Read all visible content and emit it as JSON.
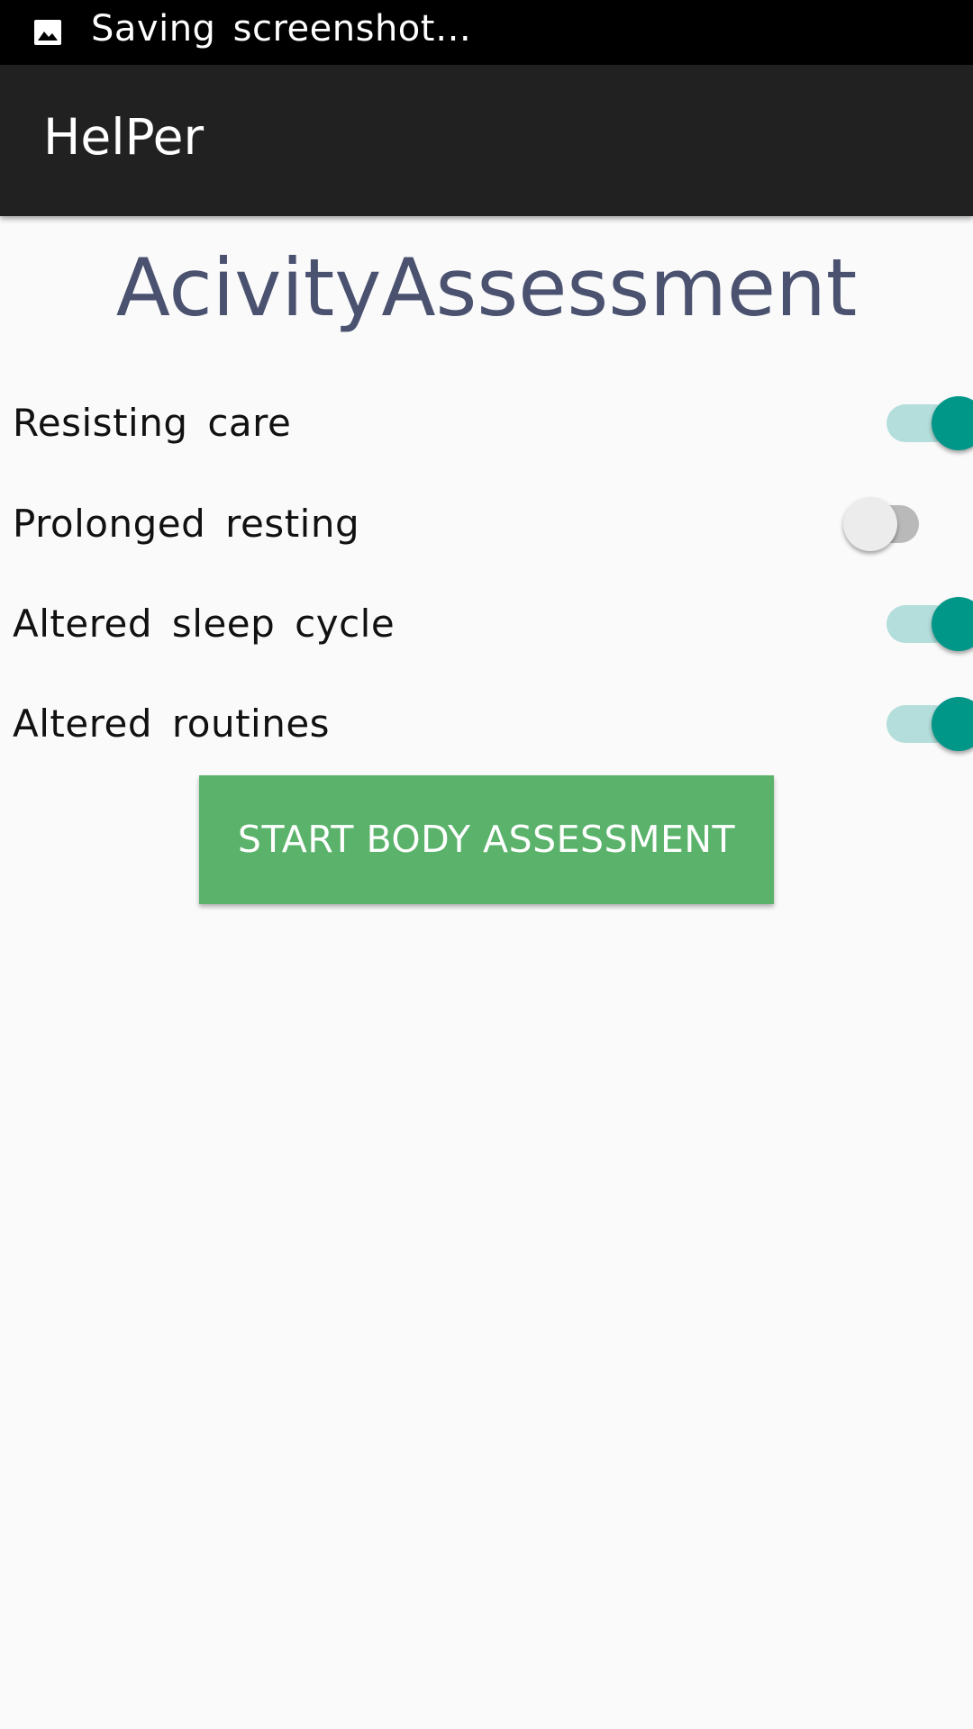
{
  "status_bar": {
    "icon": "image-icon",
    "text": "Saving screenshot…"
  },
  "app_bar": {
    "title": "HelPer"
  },
  "page": {
    "title": "AcivityAssessment"
  },
  "toggles": [
    {
      "label": "Resisting care",
      "on": true
    },
    {
      "label": "Prolonged resting",
      "on": false
    },
    {
      "label": "Altered sleep cycle",
      "on": true
    },
    {
      "label": "Altered routines",
      "on": true
    }
  ],
  "actions": {
    "start_label": "START BODY ASSESSMENT"
  },
  "colors": {
    "status_bar_bg": "#000000",
    "app_bar_bg": "#212121",
    "page_bg": "#fafafa",
    "title_color": "#4a5270",
    "switch_on_thumb": "#009688",
    "switch_on_track": "#b3dedb",
    "switch_off_thumb": "#ececec",
    "switch_off_track": "#b9b9b9",
    "button_bg": "#5ab26b"
  }
}
